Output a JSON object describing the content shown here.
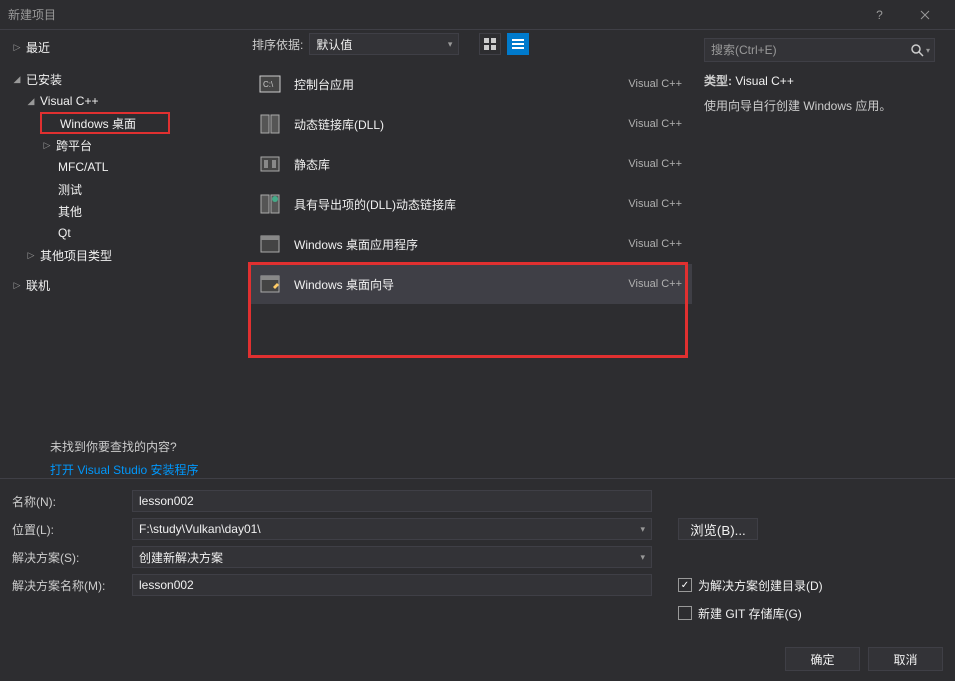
{
  "title": "新建项目",
  "sidebar": {
    "recent": "最近",
    "installed": "已安装",
    "visualcpp": "Visual C++",
    "windows_desktop": "Windows 桌面",
    "crossplatform": "跨平台",
    "mfcatl": "MFC/ATL",
    "test": "测试",
    "other": "其他",
    "qt": "Qt",
    "other_project_types": "其他项目类型",
    "online": "联机",
    "not_found": "未找到你要查找的内容?",
    "open_installer": "打开 Visual Studio 安装程序"
  },
  "center": {
    "sort_label": "排序依据:",
    "sort_value": "默认值",
    "templates": [
      {
        "name": "控制台应用",
        "lang": "Visual C++"
      },
      {
        "name": "动态链接库(DLL)",
        "lang": "Visual C++"
      },
      {
        "name": "静态库",
        "lang": "Visual C++"
      },
      {
        "name": "具有导出项的(DLL)动态链接库",
        "lang": "Visual C++"
      },
      {
        "name": "Windows 桌面应用程序",
        "lang": "Visual C++"
      },
      {
        "name": "Windows 桌面向导",
        "lang": "Visual C++"
      }
    ]
  },
  "right": {
    "search_placeholder": "搜索(Ctrl+E)",
    "type_label": "类型:",
    "type_value": "Visual C++",
    "description": "使用向导自行创建 Windows 应用。"
  },
  "form": {
    "name_label": "名称(N):",
    "name_value": "lesson002",
    "location_label": "位置(L):",
    "location_value": "F:\\study\\Vulkan\\day01\\",
    "browse": "浏览(B)...",
    "solution_label": "解决方案(S):",
    "solution_value": "创建新解决方案",
    "solution_name_label": "解决方案名称(M):",
    "solution_name_value": "lesson002",
    "create_dir": "为解决方案创建目录(D)",
    "create_git": "新建 GIT 存储库(G)"
  },
  "buttons": {
    "ok": "确定",
    "cancel": "取消"
  }
}
